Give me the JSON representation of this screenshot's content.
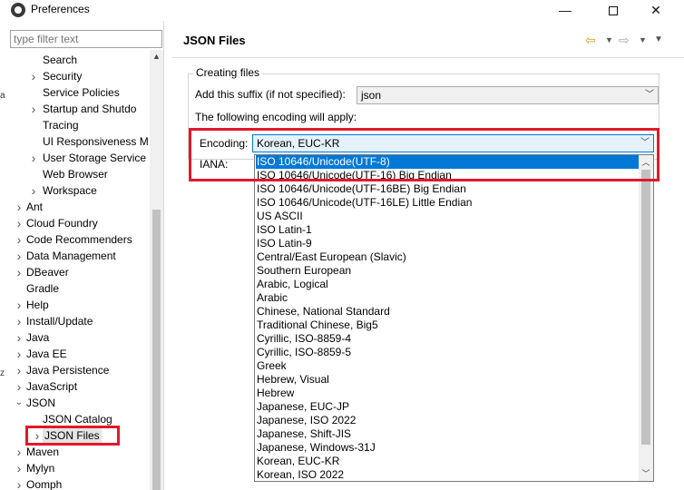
{
  "window": {
    "title": "Preferences",
    "min_glyph": "—",
    "close_glyph": "✕"
  },
  "left": {
    "filter_placeholder": "type filter text",
    "edge_marks": [
      "a",
      "z"
    ],
    "tree": [
      {
        "label": "Search",
        "expandable": false
      },
      {
        "label": "Security",
        "expandable": true
      },
      {
        "label": "Service Policies",
        "expandable": false
      },
      {
        "label": "Startup and Shutdo",
        "expandable": true
      },
      {
        "label": "Tracing",
        "expandable": false
      },
      {
        "label": "UI Responsiveness M",
        "expandable": false
      },
      {
        "label": "User Storage Service",
        "expandable": true
      },
      {
        "label": "Web Browser",
        "expandable": false
      },
      {
        "label": "Workspace",
        "expandable": true
      },
      {
        "label": "Ant",
        "expandable": true
      },
      {
        "label": "Cloud Foundry",
        "expandable": true
      },
      {
        "label": "Code Recommenders",
        "expandable": true
      },
      {
        "label": "Data Management",
        "expandable": true
      },
      {
        "label": "DBeaver",
        "expandable": true
      },
      {
        "label": "Gradle",
        "expandable": false
      },
      {
        "label": "Help",
        "expandable": true
      },
      {
        "label": "Install/Update",
        "expandable": true
      },
      {
        "label": "Java",
        "expandable": true
      },
      {
        "label": "Java EE",
        "expandable": true
      },
      {
        "label": "Java Persistence",
        "expandable": true
      },
      {
        "label": "JavaScript",
        "expandable": true
      },
      {
        "label": "JSON",
        "expandable": true,
        "expanded": true
      },
      {
        "label": "JSON Catalog",
        "expandable": false
      },
      {
        "label": "JSON Files",
        "expandable": true,
        "selected": true
      },
      {
        "label": "Maven",
        "expandable": true
      },
      {
        "label": "Mylyn",
        "expandable": true
      },
      {
        "label": "Oomph",
        "expandable": true
      }
    ]
  },
  "right": {
    "title": "JSON Files",
    "nav_icons": [
      "back-arrow-icon",
      "dropdown-icon",
      "forward-arrow-icon",
      "dropdown-icon",
      "view-menu-icon"
    ],
    "group_title": "Creating files",
    "suffix_label": "Add this suffix (if not specified):",
    "suffix_value": "json",
    "encoding_note": "The following encoding will apply:",
    "encoding_label": "Encoding:",
    "encoding_value": "Korean, EUC-KR",
    "iana_label": "IANA:",
    "encoding_options": [
      "ISO 10646/Unicode(UTF-8)",
      "ISO 10646/Unicode(UTF-16) Big Endian",
      "ISO 10646/Unicode(UTF-16BE) Big Endian",
      "ISO 10646/Unicode(UTF-16LE) Little Endian",
      "US ASCII",
      "ISO Latin-1",
      "ISO Latin-9",
      "Central/East European (Slavic)",
      "Southern European",
      "Arabic, Logical",
      "Arabic",
      "Chinese, National Standard",
      "Traditional Chinese, Big5",
      "Cyrillic, ISO-8859-4",
      "Cyrillic, ISO-8859-5",
      "Greek",
      "Hebrew, Visual",
      "Hebrew",
      "Japanese, EUC-JP",
      "Japanese, ISO 2022",
      "Japanese, Shift-JIS",
      "Japanese, Windows-31J",
      "Korean, EUC-KR",
      "Korean, ISO 2022"
    ],
    "highlighted_option": "ISO 10646/Unicode(UTF-8)"
  },
  "colors": {
    "selection": "#0078d7",
    "annotation_red": "#e2182a"
  }
}
